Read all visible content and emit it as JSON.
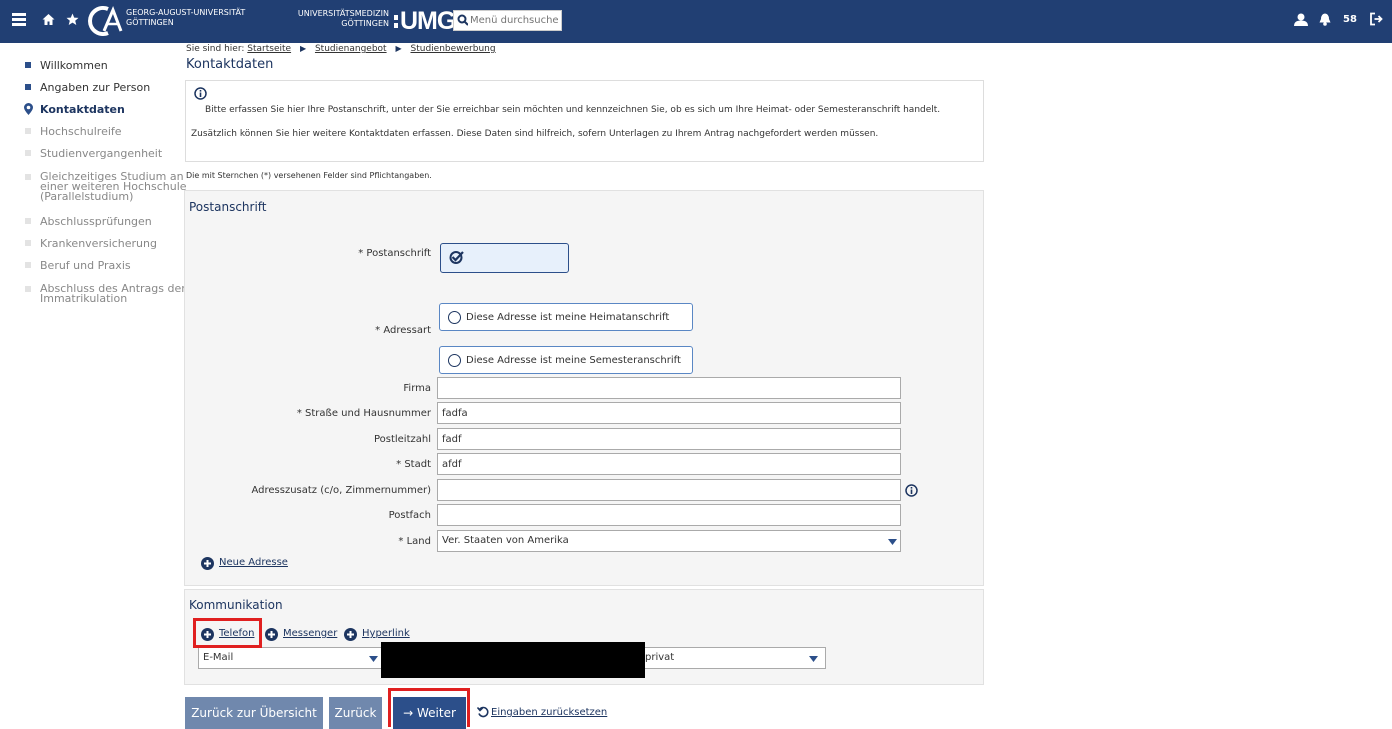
{
  "header": {
    "university_line1": "GEORG-AUGUST-UNIVERSITÄT",
    "university_line2": "GÖTTINGEN",
    "umg_line1": "UNIVERSITÄTSMEDIZIN",
    "umg_line2": "GÖTTINGEN",
    "umg_logo": "UMG",
    "search_placeholder": "Menü durchsuche",
    "count": "58",
    "icons": [
      "menu-icon",
      "home-icon",
      "star-icon",
      "user-icon",
      "bell-icon",
      "logout-icon"
    ]
  },
  "sidebar": {
    "items": [
      {
        "label": "Willkommen"
      },
      {
        "label": "Angaben zur Person"
      },
      {
        "label": "Kontaktdaten"
      },
      {
        "label": "Hochschulreife"
      },
      {
        "label": "Studienvergangenheit"
      },
      {
        "label": "Gleichzeitiges Studium an einer weiteren Hochschule (Parallelstudium)"
      },
      {
        "label": "Abschlussprüfungen"
      },
      {
        "label": "Krankenversicherung"
      },
      {
        "label": "Beruf und Praxis"
      },
      {
        "label": "Abschluss des Antrags der Immatrikulation"
      }
    ]
  },
  "breadcrumb": {
    "prefix": "Sie sind hier:",
    "items": [
      "Startseite",
      "Studienangebot",
      "Studienbewerbung"
    ]
  },
  "page_title": "Kontaktdaten",
  "info": {
    "line1": "Bitte erfassen Sie hier Ihre Postanschrift, unter der Sie erreichbar sein möchten und kennzeichnen Sie, ob es sich um Ihre Heimat- oder Semesteranschrift handelt.",
    "line2": "Zusätzlich können Sie hier weitere Kontaktdaten erfassen. Diese Daten sind hilfreich, sofern Unterlagen zu Ihrem Antrag nachgefordert werden müssen."
  },
  "required_note": "Die mit Sternchen (*) versehenen Felder sind Pflichtangaben.",
  "postanschrift": {
    "title": "Postanschrift",
    "postanschrift_label": "* Postanschrift",
    "adressart_label": "* Adressart",
    "radio_heimat": "Diese Adresse ist meine Heimatanschrift",
    "radio_semester": "Diese Adresse ist meine Semesteranschrift",
    "firma_label": "Firma",
    "firma_value": "",
    "strasse_label": "* Straße und Hausnummer",
    "strasse_value": "fadfa",
    "plz_label": "Postleitzahl",
    "plz_value": "fadf",
    "stadt_label": "* Stadt",
    "stadt_value": "afdf",
    "zusatz_label": "Adresszusatz (c/o, Zimmernummer)",
    "zusatz_value": "",
    "postfach_label": "Postfach",
    "postfach_value": "",
    "land_label": "* Land",
    "land_value": "Ver. Staaten von Amerika",
    "neue_adresse": "Neue Adresse"
  },
  "kommunikation": {
    "title": "Kommunikation",
    "telefon": "Telefon",
    "messenger": "Messenger",
    "hyperlink": "Hyperlink",
    "type_value": "E-Mail",
    "usage_value": "privat"
  },
  "buttons": {
    "back_overview": "Zurück zur Übersicht",
    "back": "Zurück",
    "next": "→  Weiter",
    "reset": "Eingaben zurücksetzen"
  },
  "colors": {
    "header_bg": "#213f73",
    "primary": "#2c4f8a",
    "secondary_button": "#7088ad",
    "highlight": "#e02020"
  }
}
